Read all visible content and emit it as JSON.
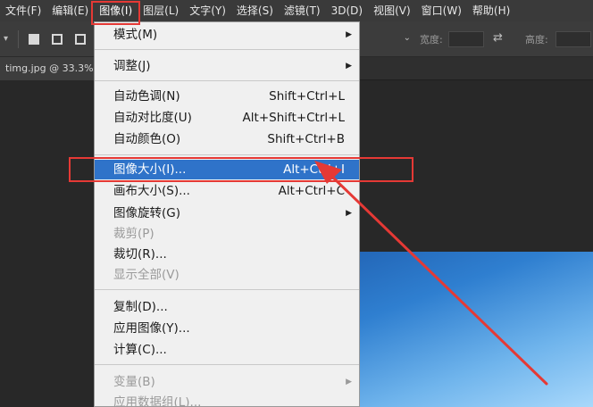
{
  "menubar": {
    "items": [
      "文件(F)",
      "编辑(E)",
      "图像(I)",
      "图层(L)",
      "文字(Y)",
      "选择(S)",
      "滤镜(T)",
      "3D(D)",
      "视图(V)",
      "窗口(W)",
      "帮助(H)"
    ],
    "active_index": 2
  },
  "options": {
    "style_value": "",
    "width_label": "宽度:",
    "height_label": "高度:"
  },
  "document": {
    "tab": "timg.jpg @ 33.3%"
  },
  "menu": {
    "mode": {
      "label": "模式(M)",
      "submenu": true
    },
    "adjust": {
      "label": "调整(J)",
      "submenu": true
    },
    "auto_tone": {
      "label": "自动色调(N)",
      "shortcut": "Shift+Ctrl+L"
    },
    "auto_contrast": {
      "label": "自动对比度(U)",
      "shortcut": "Alt+Shift+Ctrl+L"
    },
    "auto_color": {
      "label": "自动颜色(O)",
      "shortcut": "Shift+Ctrl+B"
    },
    "image_size": {
      "label": "图像大小(I)...",
      "shortcut": "Alt+Ctrl+I",
      "highlighted": true
    },
    "canvas_size": {
      "label": "画布大小(S)...",
      "shortcut": "Alt+Ctrl+C"
    },
    "image_rotation": {
      "label": "图像旋转(G)",
      "submenu": true
    },
    "crop": {
      "label": "裁剪(P)",
      "disabled": true
    },
    "trim": {
      "label": "裁切(R)..."
    },
    "reveal_all": {
      "label": "显示全部(V)",
      "disabled": true
    },
    "duplicate": {
      "label": "复制(D)..."
    },
    "apply_image": {
      "label": "应用图像(Y)..."
    },
    "calculations": {
      "label": "计算(C)..."
    },
    "variables": {
      "label": "变量(B)",
      "submenu": true,
      "disabled": true
    },
    "apply_dataset": {
      "label": "应用数据组(L)...",
      "disabled": true
    }
  },
  "colors": {
    "highlight": "#2f73c9",
    "annotation": "#e53935",
    "menu_bg": "#f0f0f0"
  }
}
